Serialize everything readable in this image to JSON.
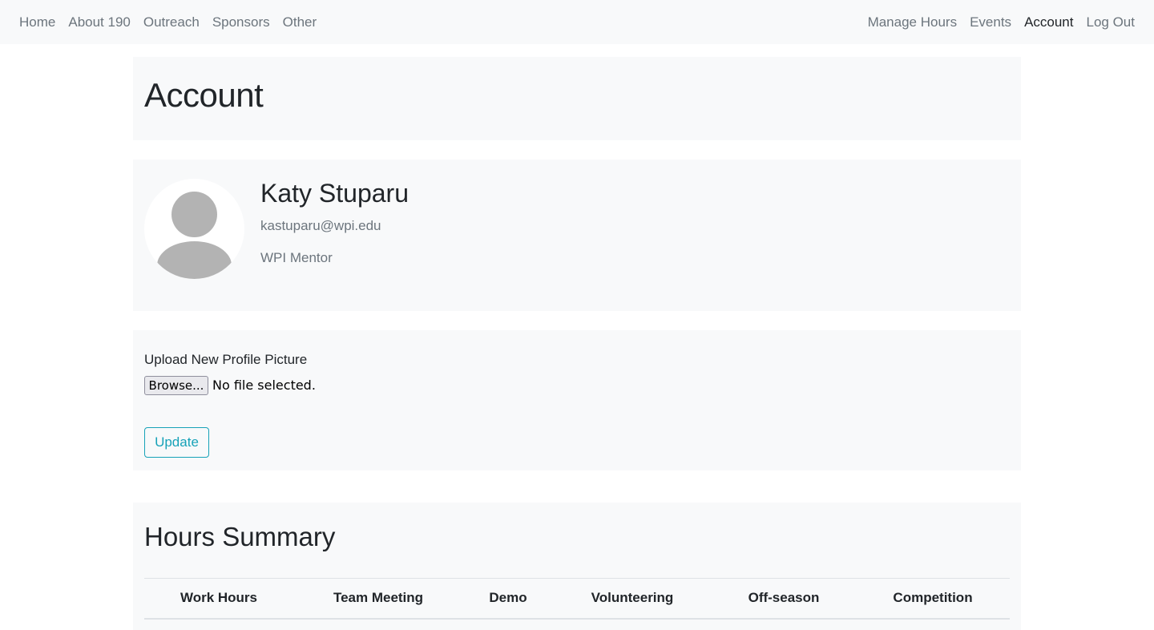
{
  "nav": {
    "left": [
      {
        "label": "Home"
      },
      {
        "label": "About 190"
      },
      {
        "label": "Outreach"
      },
      {
        "label": "Sponsors"
      },
      {
        "label": "Other"
      }
    ],
    "right": [
      {
        "label": "Manage Hours"
      },
      {
        "label": "Events"
      },
      {
        "label": "Account",
        "active": true
      },
      {
        "label": "Log Out"
      }
    ]
  },
  "page": {
    "title": "Account"
  },
  "profile": {
    "name": "Katy Stuparu",
    "email": "kastuparu@wpi.edu",
    "role": "WPI Mentor",
    "avatar_icon": "user-silhouette-icon"
  },
  "upload": {
    "label": "Upload New Profile Picture",
    "browse_label": "Browse...",
    "file_status": "No file selected.",
    "update_label": "Update",
    "update_color": "#17a2b8"
  },
  "hours_summary": {
    "title": "Hours Summary",
    "columns": [
      "Work Hours",
      "Team Meeting",
      "Demo",
      "Volunteering",
      "Off-season",
      "Competition"
    ]
  }
}
